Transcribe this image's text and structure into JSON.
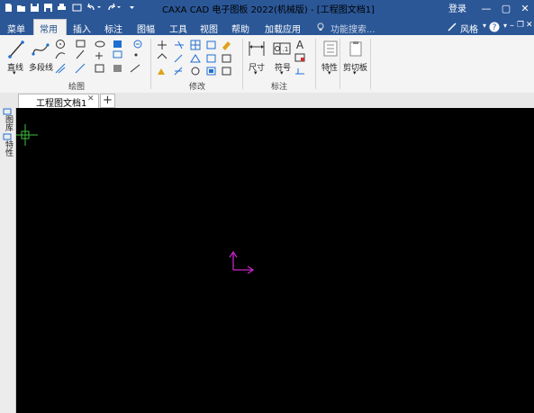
{
  "window": {
    "title": "CAXA CAD 电子图板 2022(机械版) - [工程图文档1]",
    "login": "登录"
  },
  "menu": {
    "items": [
      "菜单",
      "常用",
      "插入",
      "标注",
      "图幅",
      "工具",
      "视图",
      "帮助",
      "加载应用"
    ],
    "active_index": 1,
    "search_placeholder": "功能搜索...",
    "style": "风格"
  },
  "ribbon": {
    "draw": {
      "label": "绘图",
      "line": "直线",
      "polyline": "多段线"
    },
    "modify": {
      "label": "修改"
    },
    "annotate": {
      "label": "标注",
      "dimension": "尺寸",
      "symbol": "符号"
    },
    "properties": {
      "label": "特性"
    },
    "clipboard": {
      "label": "剪切板"
    }
  },
  "document": {
    "tab": "工程图文档1"
  },
  "side_panel": {
    "tab1": "图库",
    "tab2": "特性"
  },
  "colors": {
    "title_bar": "#2b5797",
    "ucs_axis": "#c724c7",
    "cursor": "#3fbf3f"
  }
}
